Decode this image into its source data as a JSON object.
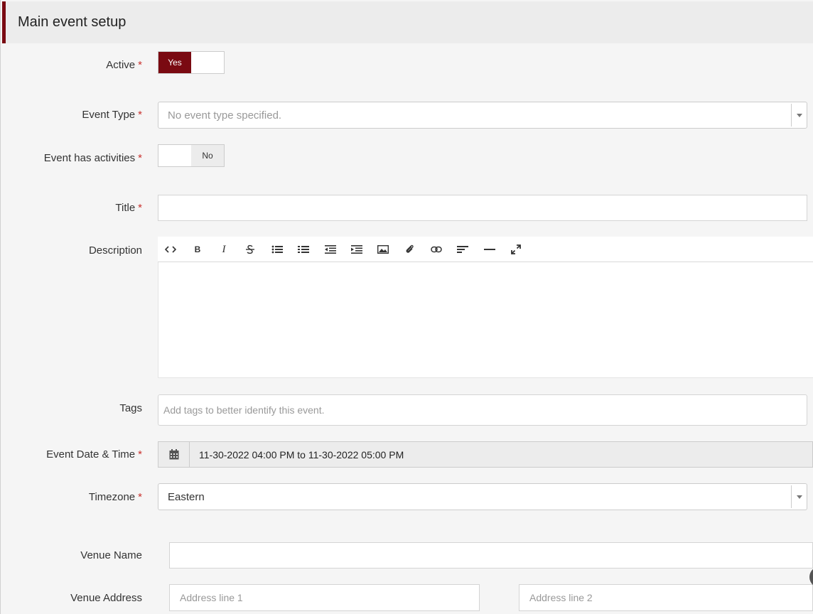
{
  "header": {
    "title": "Main event setup"
  },
  "required_mark": "*",
  "fields": {
    "active": {
      "label": "Active",
      "on_label": "Yes"
    },
    "event_type": {
      "label": "Event Type",
      "placeholder": "No event type specified."
    },
    "has_activities": {
      "label": "Event has activities",
      "off_label": "No"
    },
    "title": {
      "label": "Title",
      "value": ""
    },
    "description": {
      "label": "Description",
      "value": ""
    },
    "tags": {
      "label": "Tags",
      "placeholder": "Add tags to better identify this event."
    },
    "event_date": {
      "label": "Event Date & Time",
      "value": "11-30-2022 04:00 PM to 11-30-2022 05:00 PM"
    },
    "timezone": {
      "label": "Timezone",
      "value": "Eastern"
    },
    "venue_name": {
      "label": "Venue Name",
      "value": ""
    },
    "venue_address": {
      "label": "Venue Address",
      "line1_placeholder": "Address line 1",
      "line2_placeholder": "Address line 2"
    }
  },
  "editor_toolbar": [
    "code-icon",
    "bold-icon",
    "italic-icon",
    "strikethrough-icon",
    "bullet-list-icon",
    "numbered-list-icon",
    "outdent-icon",
    "indent-icon",
    "image-icon",
    "attachment-icon",
    "link-icon",
    "align-icon",
    "horizontal-rule-icon",
    "fullscreen-icon"
  ],
  "colors": {
    "accent": "#7a0a12",
    "required": "#c9302c"
  }
}
